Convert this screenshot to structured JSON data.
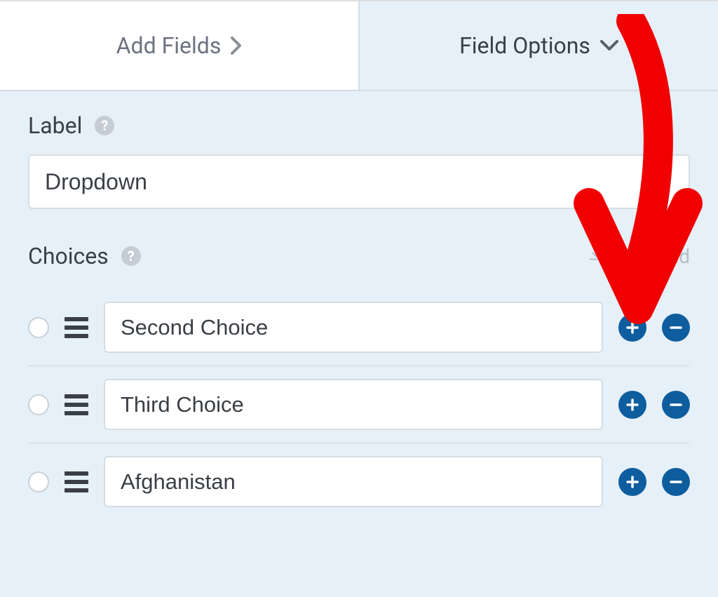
{
  "tabs": {
    "add_fields_label": "Add Fields",
    "field_options_label": "Field Options"
  },
  "label_section": {
    "title": "Label",
    "value": "Dropdown"
  },
  "choices_section": {
    "title": "Choices",
    "bulk_label": "Bulk Add"
  },
  "choices": [
    {
      "value": "Second Choice"
    },
    {
      "value": "Third Choice"
    },
    {
      "value": "Afghanistan"
    }
  ],
  "colors": {
    "accent": "#0e5d9e",
    "panel_bg": "#e6f0f8",
    "arrow": "#f00000"
  }
}
